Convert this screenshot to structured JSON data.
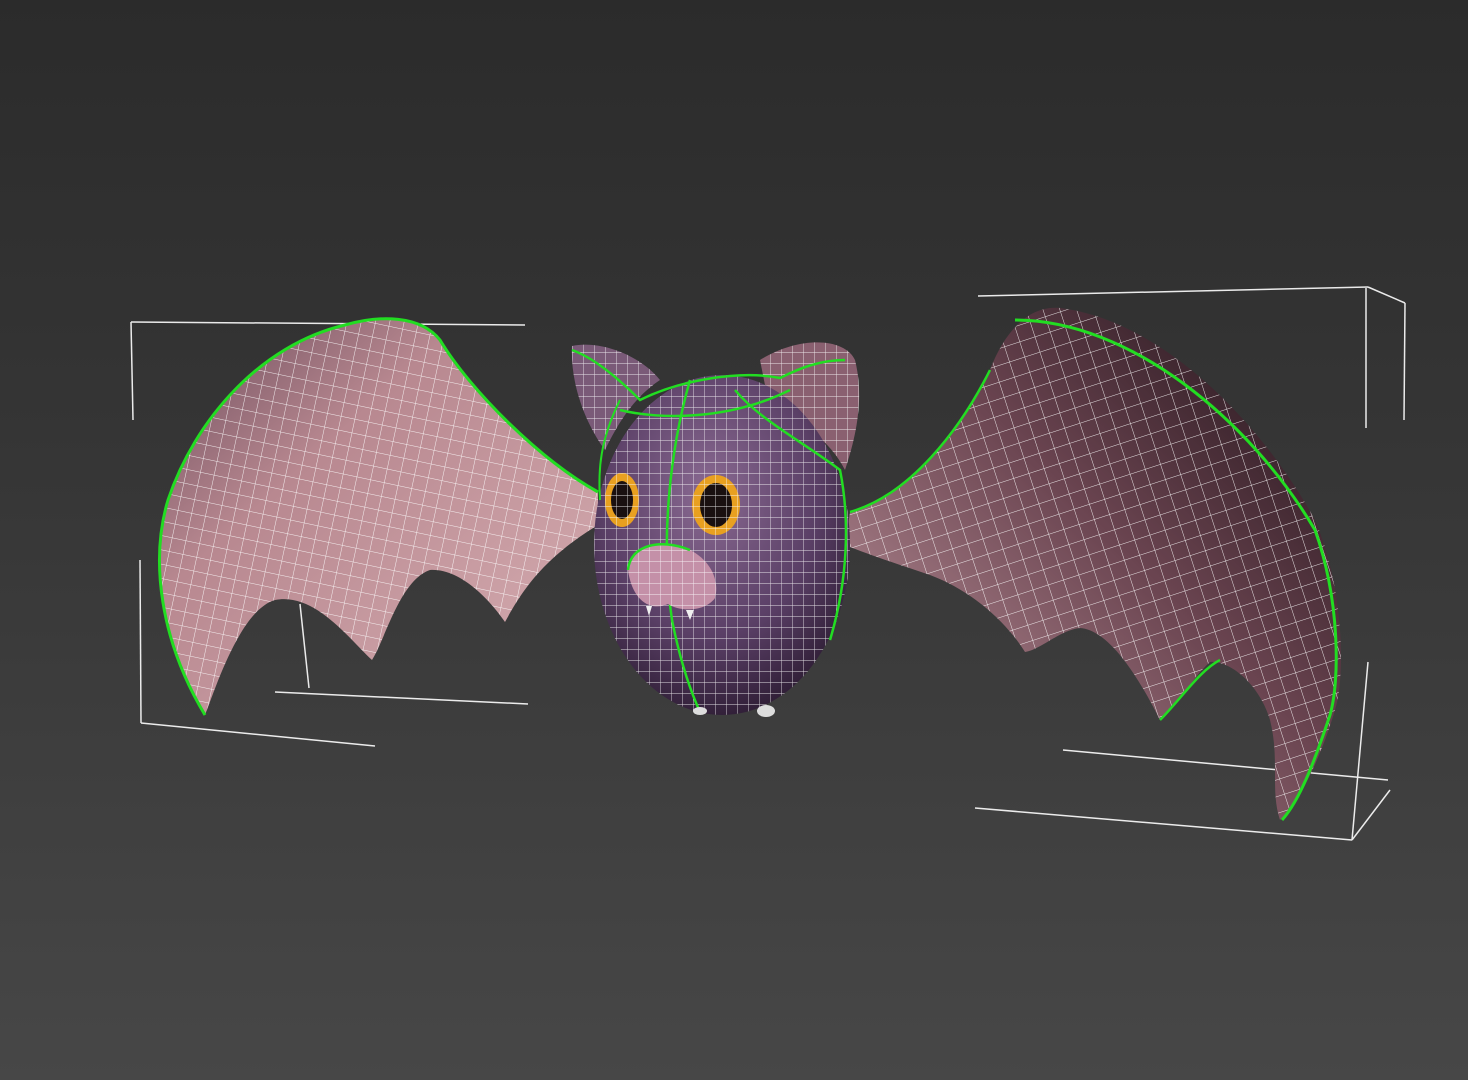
{
  "viewport": {
    "background_top": "#2b2b2b",
    "background_bottom": "#474747"
  },
  "model": {
    "subject": "bat",
    "wireframe_color": "#ffffff",
    "selection_edge_color": "#22dd22",
    "bounding_box_color": "#ffffff",
    "body_color": "#5a3f66",
    "wing_color": "#b08088",
    "eye_color": "#e8a020"
  }
}
